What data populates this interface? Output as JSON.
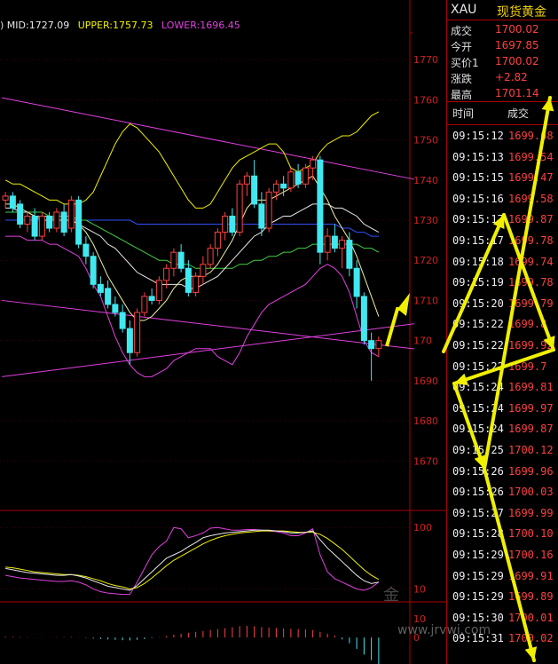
{
  "indicator": {
    "mid_label": "MID:1727.09",
    "upper_label": "UPPER:1757.73",
    "lower_label": "LOWER:1696.45",
    "lead": ")"
  },
  "quote": {
    "symbol": "XAU",
    "name": "现货黄金",
    "rows": [
      {
        "label": "成交",
        "value": "1700.02"
      },
      {
        "label": "今开",
        "value": "1697.85"
      },
      {
        "label": "买价1",
        "value": "1700.02"
      },
      {
        "label": "涨跌",
        "value": "+2.82"
      },
      {
        "label": "最高",
        "value": "1701.14"
      }
    ]
  },
  "ticks": {
    "col_time": "时间",
    "col_price": "成交",
    "rows": [
      {
        "time": "09:15:12",
        "price": "1699.68"
      },
      {
        "time": "09:15:13",
        "price": "1699.54"
      },
      {
        "time": "09:15:15",
        "price": "1699.47"
      },
      {
        "time": "09:15:16",
        "price": "1699.58"
      },
      {
        "time": "09:15:17",
        "price": "1699.87"
      },
      {
        "time": "09:15:17",
        "price": "1699.78"
      },
      {
        "time": "09:15:18",
        "price": "1699.74"
      },
      {
        "time": "09:15:19",
        "price": "1699.78"
      },
      {
        "time": "09:15:20",
        "price": "1699.79"
      },
      {
        "time": "09:15:22",
        "price": "1699.8"
      },
      {
        "time": "09:15:22",
        "price": "1699.92"
      },
      {
        "time": "09:15:22",
        "price": "1699.7"
      },
      {
        "time": "09:15:24",
        "price": "1699.81"
      },
      {
        "time": "09:15:24",
        "price": "1699.97"
      },
      {
        "time": "09:15:24",
        "price": "1699.87"
      },
      {
        "time": "09:15:25",
        "price": "1700.12"
      },
      {
        "time": "09:15:26",
        "price": "1699.96"
      },
      {
        "time": "09:15:26",
        "price": "1700.03"
      },
      {
        "time": "09:15:27",
        "price": "1699.99"
      },
      {
        "time": "09:15:28",
        "price": "1700.10"
      },
      {
        "time": "09:15:29",
        "price": "1700.16"
      },
      {
        "time": "09:15:29",
        "price": "1699.91"
      },
      {
        "time": "09:15:29",
        "price": "1699.89"
      },
      {
        "time": "09:15:30",
        "price": "1700.01"
      },
      {
        "time": "09:15:31",
        "price": "1700.02"
      }
    ]
  },
  "watermark": {
    "brand": "金",
    "url": "www.jrvwi.com"
  },
  "colors": {
    "bull": "#ff4040",
    "bear": "#40e8f0",
    "upper": "#f0f000",
    "mid": "#e8e8e8",
    "lower": "#e040e0",
    "ma_blue": "#3050ff",
    "ma_green": "#40d040",
    "axis": "#aa0000",
    "annotation": "#f0f000"
  },
  "chart_data": {
    "type": "candlestick",
    "main": {
      "ylim": [
        1661,
        1776
      ],
      "y_ticks": [
        1770,
        1760,
        1750,
        1740,
        1730,
        1720,
        1710,
        1700,
        1690,
        1680,
        1670
      ],
      "y_tick_labels": [
        "1770",
        "1760",
        "1750",
        "1740",
        "1730",
        "1720",
        "1710",
        "170",
        "1690",
        "1680",
        "1670"
      ],
      "candles": [
        {
          "o": 1735,
          "h": 1737,
          "l": 1733,
          "c": 1736
        },
        {
          "o": 1736,
          "h": 1737,
          "l": 1732,
          "c": 1733
        },
        {
          "o": 1734,
          "h": 1735,
          "l": 1728,
          "c": 1729
        },
        {
          "o": 1729,
          "h": 1732,
          "l": 1727,
          "c": 1731
        },
        {
          "o": 1731,
          "h": 1733,
          "l": 1725,
          "c": 1726
        },
        {
          "o": 1726,
          "h": 1732,
          "l": 1725,
          "c": 1731
        },
        {
          "o": 1731,
          "h": 1732,
          "l": 1727,
          "c": 1728
        },
        {
          "o": 1728,
          "h": 1733,
          "l": 1727,
          "c": 1732
        },
        {
          "o": 1732,
          "h": 1734,
          "l": 1726,
          "c": 1727
        },
        {
          "o": 1728,
          "h": 1736,
          "l": 1727,
          "c": 1735
        },
        {
          "o": 1735,
          "h": 1736,
          "l": 1723,
          "c": 1724
        },
        {
          "o": 1724,
          "h": 1726,
          "l": 1719,
          "c": 1721
        },
        {
          "o": 1721,
          "h": 1722,
          "l": 1713,
          "c": 1714
        },
        {
          "o": 1714,
          "h": 1716,
          "l": 1711,
          "c": 1712
        },
        {
          "o": 1713,
          "h": 1715,
          "l": 1708,
          "c": 1709
        },
        {
          "o": 1709,
          "h": 1711,
          "l": 1706,
          "c": 1707
        },
        {
          "o": 1707,
          "h": 1709,
          "l": 1702,
          "c": 1703
        },
        {
          "o": 1703,
          "h": 1705,
          "l": 1694,
          "c": 1697
        },
        {
          "o": 1697,
          "h": 1708,
          "l": 1696,
          "c": 1707
        },
        {
          "o": 1707,
          "h": 1712,
          "l": 1706,
          "c": 1711
        },
        {
          "o": 1711,
          "h": 1713,
          "l": 1709,
          "c": 1710
        },
        {
          "o": 1710,
          "h": 1716,
          "l": 1709,
          "c": 1715
        },
        {
          "o": 1715,
          "h": 1719,
          "l": 1713,
          "c": 1718
        },
        {
          "o": 1718,
          "h": 1723,
          "l": 1716,
          "c": 1722
        },
        {
          "o": 1722,
          "h": 1724,
          "l": 1717,
          "c": 1718
        },
        {
          "o": 1718,
          "h": 1720,
          "l": 1711,
          "c": 1712
        },
        {
          "o": 1712,
          "h": 1717,
          "l": 1711,
          "c": 1716
        },
        {
          "o": 1716,
          "h": 1721,
          "l": 1714,
          "c": 1719
        },
        {
          "o": 1719,
          "h": 1724,
          "l": 1718,
          "c": 1723
        },
        {
          "o": 1723,
          "h": 1728,
          "l": 1721,
          "c": 1727
        },
        {
          "o": 1727,
          "h": 1732,
          "l": 1725,
          "c": 1731
        },
        {
          "o": 1731,
          "h": 1733,
          "l": 1726,
          "c": 1727
        },
        {
          "o": 1727,
          "h": 1740,
          "l": 1726,
          "c": 1739
        },
        {
          "o": 1739,
          "h": 1742,
          "l": 1736,
          "c": 1741
        },
        {
          "o": 1741,
          "h": 1745,
          "l": 1733,
          "c": 1734
        },
        {
          "o": 1734,
          "h": 1737,
          "l": 1726,
          "c": 1728
        },
        {
          "o": 1728,
          "h": 1738,
          "l": 1727,
          "c": 1737
        },
        {
          "o": 1737,
          "h": 1740,
          "l": 1735,
          "c": 1739
        },
        {
          "o": 1739,
          "h": 1741,
          "l": 1736,
          "c": 1738
        },
        {
          "o": 1738,
          "h": 1743,
          "l": 1737,
          "c": 1742
        },
        {
          "o": 1742,
          "h": 1744,
          "l": 1738,
          "c": 1739
        },
        {
          "o": 1739,
          "h": 1744,
          "l": 1738,
          "c": 1743
        },
        {
          "o": 1743,
          "h": 1746,
          "l": 1740,
          "c": 1745
        },
        {
          "o": 1745,
          "h": 1746,
          "l": 1719,
          "c": 1722
        },
        {
          "o": 1722,
          "h": 1728,
          "l": 1720,
          "c": 1726
        },
        {
          "o": 1726,
          "h": 1729,
          "l": 1722,
          "c": 1723
        },
        {
          "o": 1723,
          "h": 1726,
          "l": 1718,
          "c": 1725
        },
        {
          "o": 1725,
          "h": 1727,
          "l": 1716,
          "c": 1718
        },
        {
          "o": 1718,
          "h": 1720,
          "l": 1708,
          "c": 1711
        },
        {
          "o": 1711,
          "h": 1712,
          "l": 1699,
          "c": 1700
        },
        {
          "o": 1700,
          "h": 1702,
          "l": 1690,
          "c": 1698
        },
        {
          "o": 1698,
          "h": 1701,
          "l": 1696,
          "c": 1700
        }
      ],
      "boll_upper": [
        1740,
        1739,
        1739,
        1738,
        1737,
        1736,
        1735,
        1735,
        1734,
        1734,
        1734,
        1735,
        1737,
        1741,
        1745,
        1749,
        1752,
        1754,
        1753,
        1751,
        1749,
        1747,
        1744,
        1741,
        1738,
        1735,
        1733,
        1733,
        1734,
        1737,
        1740,
        1743,
        1745,
        1746,
        1747,
        1748,
        1749,
        1749,
        1747,
        1743,
        1742,
        1743,
        1744,
        1747,
        1749,
        1750,
        1751,
        1751,
        1752,
        1754,
        1756,
        1757
      ],
      "boll_mid": [
        1733,
        1733,
        1732,
        1732,
        1731,
        1731,
        1731,
        1730,
        1730,
        1730,
        1729,
        1728,
        1727,
        1726,
        1724,
        1723,
        1721,
        1719,
        1717,
        1716,
        1715,
        1714,
        1714,
        1714,
        1714,
        1713,
        1713,
        1714,
        1715,
        1716,
        1718,
        1720,
        1722,
        1724,
        1726,
        1727,
        1729,
        1730,
        1731,
        1731,
        1732,
        1733,
        1734,
        1734,
        1734,
        1733,
        1733,
        1732,
        1731,
        1729,
        1728,
        1727
      ],
      "boll_lower": [
        1726,
        1726,
        1726,
        1725,
        1725,
        1725,
        1724,
        1724,
        1723,
        1722,
        1721,
        1718,
        1714,
        1711,
        1706,
        1701,
        1697,
        1694,
        1692,
        1691,
        1691,
        1692,
        1693,
        1695,
        1696,
        1697,
        1698,
        1698,
        1698,
        1696,
        1695,
        1694,
        1697,
        1701,
        1704,
        1707,
        1709,
        1710,
        1711,
        1712,
        1713,
        1714,
        1716,
        1718,
        1719,
        1718,
        1716,
        1712,
        1706,
        1700,
        1697,
        1696
      ],
      "ma_blue": [
        1730,
        1730,
        1730,
        1730,
        1730,
        1730,
        1730,
        1730,
        1730,
        1730,
        1730,
        1730,
        1730,
        1730,
        1730,
        1730,
        1730,
        1730,
        1729,
        1729,
        1729,
        1729,
        1729,
        1729,
        1729,
        1729,
        1729,
        1729,
        1729,
        1729,
        1729,
        1729,
        1729,
        1729,
        1729,
        1729,
        1729,
        1729,
        1729,
        1729,
        1729,
        1729,
        1729,
        1729,
        1729,
        1729,
        1728,
        1728,
        1727,
        1727,
        1726,
        1726
      ],
      "ma_green": [
        1732,
        1732,
        1732,
        1732,
        1732,
        1732,
        1731,
        1731,
        1731,
        1731,
        1730,
        1730,
        1729,
        1728,
        1727,
        1726,
        1725,
        1724,
        1723,
        1722,
        1721,
        1720,
        1720,
        1719,
        1719,
        1719,
        1718,
        1718,
        1718,
        1718,
        1718,
        1718,
        1719,
        1719,
        1720,
        1720,
        1721,
        1721,
        1722,
        1722,
        1723,
        1723,
        1724,
        1724,
        1724,
        1724,
        1724,
        1724,
        1724,
        1723,
        1723,
        1722
      ],
      "ma_fast": [
        1734,
        1734,
        1733,
        1732,
        1731,
        1730,
        1730,
        1730,
        1730,
        1730,
        1729,
        1727,
        1724,
        1720,
        1716,
        1713,
        1710,
        1707,
        1705,
        1705,
        1706,
        1708,
        1710,
        1713,
        1715,
        1716,
        1716,
        1716,
        1717,
        1719,
        1722,
        1725,
        1729,
        1733,
        1735,
        1735,
        1735,
        1736,
        1737,
        1738,
        1739,
        1740,
        1741,
        1738,
        1735,
        1731,
        1728,
        1725,
        1721,
        1716,
        1711,
        1706
      ],
      "trendlines": [
        {
          "p1": [
            0,
            1760.5
          ],
          "p2": [
            51,
            1742
          ]
        },
        {
          "p1": [
            0,
            1710
          ],
          "p2": [
            51,
            1699
          ]
        },
        {
          "p1": [
            0,
            1691
          ],
          "p2": [
            51,
            1703
          ]
        }
      ]
    },
    "oscillator": {
      "ylim": [
        -5,
        112
      ],
      "y_ticks": [
        100,
        10
      ],
      "y_tick_labels": [
        "100",
        "10"
      ],
      "k": [
        40,
        38,
        36,
        34,
        33,
        32,
        31,
        30,
        30,
        31,
        29,
        26,
        22,
        18,
        14,
        12,
        10,
        8,
        15,
        25,
        35,
        45,
        55,
        60,
        65,
        72,
        78,
        85,
        88,
        90,
        92,
        93,
        94,
        95,
        96,
        96,
        96,
        95,
        94,
        92,
        92,
        93,
        95,
        82,
        70,
        60,
        50,
        40,
        30,
        22,
        18,
        20
      ],
      "d": [
        42,
        41,
        39,
        37,
        35,
        34,
        33,
        32,
        31,
        31,
        30,
        28,
        25,
        22,
        18,
        15,
        13,
        10,
        12,
        18,
        26,
        35,
        44,
        52,
        58,
        64,
        70,
        76,
        81,
        85,
        88,
        90,
        92,
        93,
        94,
        95,
        95,
        95,
        95,
        94,
        93,
        93,
        93,
        90,
        84,
        76,
        68,
        58,
        48,
        38,
        30,
        24
      ],
      "j": [
        30,
        28,
        26,
        25,
        24,
        23,
        22,
        21,
        21,
        22,
        20,
        16,
        10,
        6,
        4,
        3,
        2,
        2,
        20,
        40,
        60,
        72,
        80,
        100,
        98,
        85,
        88,
        92,
        99,
        100,
        98,
        96,
        96,
        97,
        97,
        96,
        95,
        94,
        92,
        88,
        88,
        92,
        98,
        60,
        35,
        25,
        20,
        15,
        10,
        8,
        12,
        20
      ]
    },
    "macd": {
      "ylim": [
        -14,
        17
      ],
      "y_ticks": [
        10,
        0
      ],
      "y_tick_labels": [
        "10",
        "0"
      ],
      "hist": [
        0.5,
        0.4,
        0.3,
        0.2,
        0.1,
        0.1,
        0.1,
        0.2,
        0.2,
        0.3,
        0.1,
        -0.2,
        -0.5,
        -0.8,
        -1,
        -1.2,
        -1.4,
        -1.5,
        -1.2,
        -0.8,
        -0.3,
        0.2,
        0.8,
        1.5,
        2,
        2.5,
        3,
        3.5,
        4,
        4.5,
        5,
        5.5,
        6,
        6.2,
        6,
        5.5,
        5.2,
        5,
        4.8,
        4.6,
        4.5,
        4.4,
        4,
        3,
        2,
        1,
        -1,
        -3,
        -6,
        -9,
        -12,
        -14
      ]
    }
  }
}
